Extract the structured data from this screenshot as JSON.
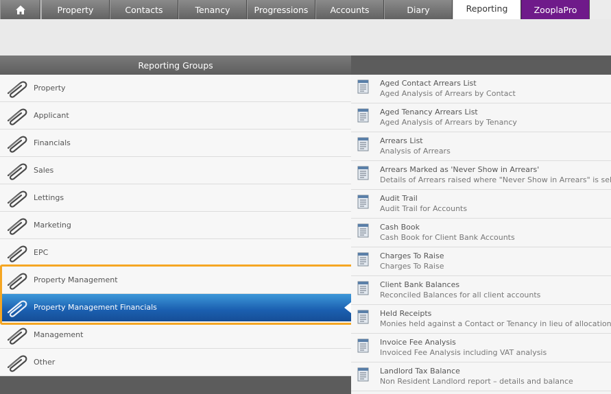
{
  "nav": {
    "tabs": [
      {
        "label": "Property"
      },
      {
        "label": "Contacts"
      },
      {
        "label": "Tenancy"
      },
      {
        "label": "Progressions"
      },
      {
        "label": "Accounts"
      },
      {
        "label": "Diary"
      },
      {
        "label": "Reporting"
      },
      {
        "label": "ZooplaPro"
      }
    ],
    "active_tab": "Reporting",
    "zoopla_color": "#6f1a8a"
  },
  "groups": {
    "header": "Reporting Groups",
    "items": [
      {
        "label": "Property"
      },
      {
        "label": "Applicant"
      },
      {
        "label": "Financials"
      },
      {
        "label": "Sales"
      },
      {
        "label": "Lettings"
      },
      {
        "label": "Marketing"
      },
      {
        "label": "EPC"
      },
      {
        "label": "Property Management"
      },
      {
        "label": "Property Management Financials"
      },
      {
        "label": "Management"
      },
      {
        "label": "Other"
      }
    ],
    "selected": "Property Management Financials",
    "selected_color": "#1b5fb0",
    "highlight_color": "#f5a623"
  },
  "reports": {
    "items": [
      {
        "title": "Aged Contact Arrears List",
        "desc": "Aged Analysis of Arrears by Contact"
      },
      {
        "title": "Aged Tenancy Arrears List",
        "desc": "Aged Analysis of Arrears by Tenancy"
      },
      {
        "title": "Arrears List",
        "desc": "Analysis of Arrears"
      },
      {
        "title": "Arrears Marked as 'Never Show in Arrears'",
        "desc": "Details of Arrears raised where \"Never Show in Arrears\" is selected"
      },
      {
        "title": "Audit Trail",
        "desc": "Audit Trail for Accounts"
      },
      {
        "title": "Cash Book",
        "desc": "Cash Book for Client Bank Accounts"
      },
      {
        "title": "Charges To Raise",
        "desc": "Charges To Raise"
      },
      {
        "title": "Client Bank Balances",
        "desc": "Reconciled Balances for all client accounts"
      },
      {
        "title": "Held Receipts",
        "desc": "Monies held against a Contact or Tenancy in lieu of allocation to an ou"
      },
      {
        "title": "Invoice Fee Analysis",
        "desc": "Invoiced Fee Analysis including VAT analysis"
      },
      {
        "title": "Landlord Tax Balance",
        "desc": "Non Resident Landlord report – details and balance"
      }
    ]
  }
}
